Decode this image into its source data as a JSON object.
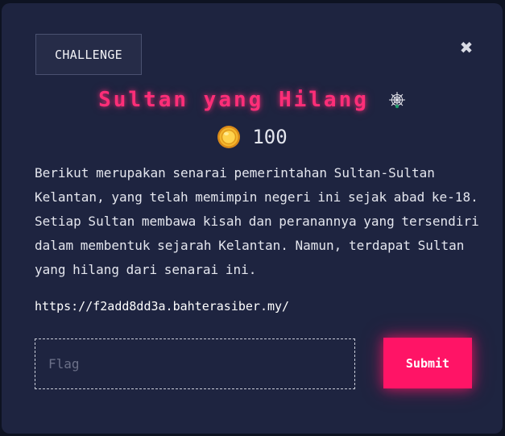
{
  "modal": {
    "tab_label": "CHALLENGE",
    "close_glyph": "✖",
    "title": "Sultan yang Hilang",
    "title_icon": "spider-web-icon",
    "points_icon": "coin-icon",
    "points": "100",
    "description": "Berikut merupakan senarai pemerintahan Sultan-Sultan Kelantan, yang telah memimpin negeri ini sejak abad ke-18. Setiap Sultan membawa kisah dan peranannya yang tersendiri dalam membentuk sejarah Kelantan. Namun, terdapat Sultan yang hilang dari senarai ini.",
    "link": "https://f2add8dd3a.bahterasiber.my/",
    "flag_placeholder": "Flag",
    "flag_value": "",
    "submit_label": "Submit"
  },
  "colors": {
    "background": "#0e1322",
    "modal": "#1e2440",
    "title": "#ff2e78",
    "submit": "#ff1466",
    "text": "#e4e6ee"
  }
}
